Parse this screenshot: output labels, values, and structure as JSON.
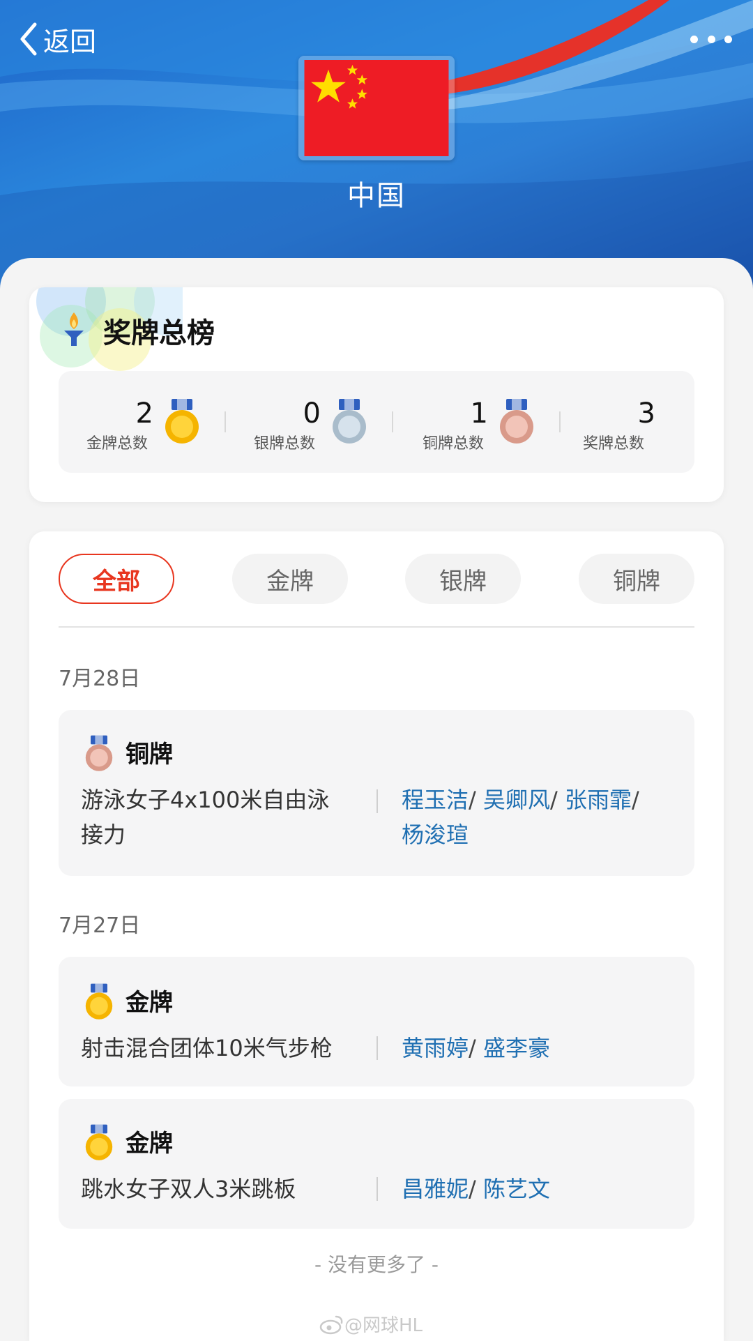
{
  "header": {
    "back_label": "返回",
    "country_name": "中国"
  },
  "summary": {
    "title": "奖牌总榜",
    "tallies": [
      {
        "count": "2",
        "label": "金牌总数",
        "medal": "gold-medal-icon"
      },
      {
        "count": "0",
        "label": "银牌总数",
        "medal": "silver-medal-icon"
      },
      {
        "count": "1",
        "label": "铜牌总数",
        "medal": "bronze-medal-icon"
      },
      {
        "count": "3",
        "label": "奖牌总数",
        "medal": ""
      }
    ]
  },
  "tabs": [
    {
      "label": "全部",
      "active": true
    },
    {
      "label": "金牌",
      "active": false
    },
    {
      "label": "银牌",
      "active": false
    },
    {
      "label": "铜牌",
      "active": false
    }
  ],
  "groups": [
    {
      "date": "7月28日",
      "events": [
        {
          "medal_type": "铜牌",
          "event_lines": [
            "游泳女子4x100米自由泳",
            "接力"
          ],
          "athletes": [
            "程玉洁",
            "吴卿风",
            "张雨霏",
            "杨浚瑄"
          ]
        }
      ]
    },
    {
      "date": "7月27日",
      "events": [
        {
          "medal_type": "金牌",
          "event_lines": [
            "射击混合团体10米气步枪"
          ],
          "athletes": [
            "黄雨婷",
            "盛李豪"
          ]
        },
        {
          "medal_type": "金牌",
          "event_lines": [
            "跳水女子双人3米跳板"
          ],
          "athletes": [
            "昌雅妮",
            "陈艺文"
          ]
        }
      ]
    }
  ],
  "footer": {
    "no_more": "- 没有更多了 -",
    "watermark": "@网球HL"
  },
  "colors": {
    "accent": "#e8361f",
    "athlete_link": "#1f6fb2",
    "gold": "#f5b400",
    "silver": "#b8c7d4",
    "bronze": "#e2aa9c",
    "ribbon": "#2f5fbf"
  }
}
